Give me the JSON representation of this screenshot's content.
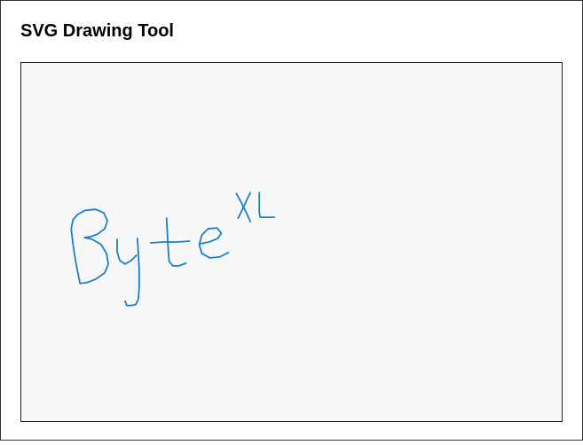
{
  "app": {
    "title": "SVG Drawing Tool"
  },
  "canvas": {
    "background": "#f8f8f8",
    "stroke_color": "#1a80c8"
  }
}
